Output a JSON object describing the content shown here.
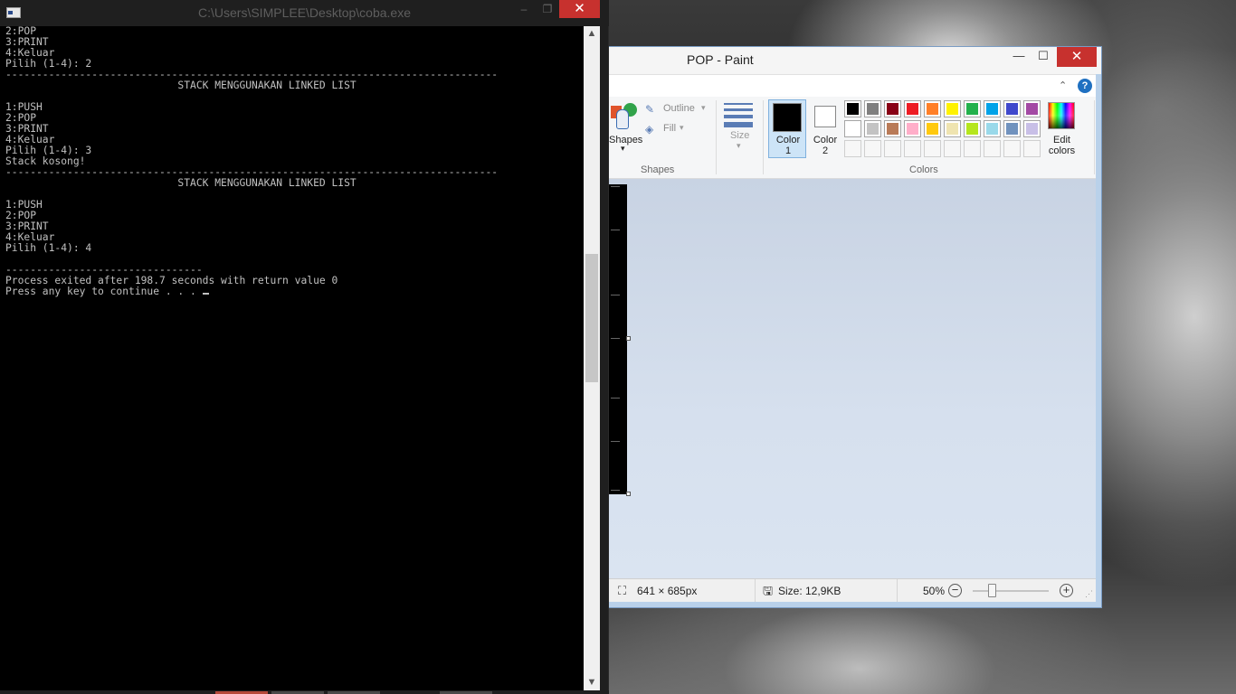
{
  "console": {
    "title": "C:\\Users\\SIMPLEE\\Desktop\\coba.exe",
    "buttons": {
      "minimize": "–",
      "maximize": "❐",
      "close": "✕"
    },
    "lines": [
      "2:POP",
      "3:PRINT",
      "4:Keluar",
      "Pilih (1-4): 2",
      "--------------------------------------------------------------------------------",
      "                            STACK MENGGUNAKAN LINKED LIST",
      "",
      "1:PUSH",
      "2:POP",
      "3:PRINT",
      "4:Keluar",
      "Pilih (1-4): 3",
      "Stack kosong!",
      "--------------------------------------------------------------------------------",
      "                            STACK MENGGUNAKAN LINKED LIST",
      "",
      "1:PUSH",
      "2:POP",
      "3:PRINT",
      "4:Keluar",
      "Pilih (1-4): 4",
      "",
      "--------------------------------",
      "Process exited after 198.7 seconds with return value 0",
      "Press any key to continue . . . "
    ],
    "scroll_up": "▲",
    "scroll_down": "▼"
  },
  "paint": {
    "title": "POP - Paint",
    "buttons": {
      "minimize": "—",
      "maximize": "☐",
      "close": "✕"
    },
    "collapse_ribbon": "⌃",
    "help": "?",
    "ribbon": {
      "shapes_label": "Shapes",
      "shapes_dropdown": "▾",
      "outline_label": "Outline",
      "fill_label": "Fill",
      "dropdown_arrow": "▾",
      "group_shapes": "Shapes",
      "size_label": "Size",
      "color1_label": "Color\n1",
      "color2_label": "Color\n2",
      "group_colors": "Colors",
      "edit_colors_label": "Edit\ncolors"
    },
    "palette_row1": [
      "#000000",
      "#7f7f7f",
      "#880015",
      "#ed1c24",
      "#ff7f27",
      "#fff200",
      "#22b14c",
      "#00a2e8",
      "#3f48cc",
      "#a349a4"
    ],
    "palette_row2": [
      "#ffffff",
      "#c3c3c3",
      "#b97a57",
      "#ffaec9",
      "#ffc90e",
      "#efe4b0",
      "#b5e61d",
      "#99d9ea",
      "#7092be",
      "#c8bfe7"
    ],
    "palette_row3_empty": 10,
    "status": {
      "dimensions": "641 × 685px",
      "size": "Size: 12,9KB",
      "zoom": "50%",
      "zoom_out": "−",
      "zoom_in": "+"
    },
    "color1": "#000000",
    "color2": "#ffffff"
  }
}
